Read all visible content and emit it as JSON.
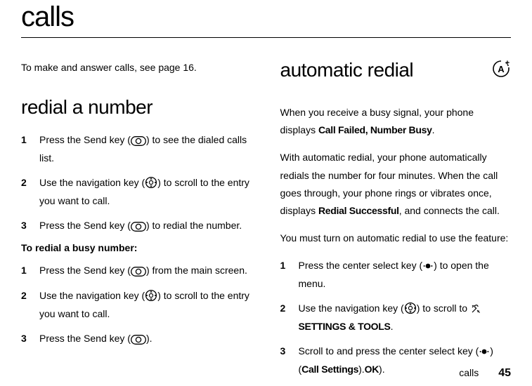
{
  "page_title": "calls",
  "intro": "To make and answer calls, see page 16.",
  "left": {
    "heading": "redial a number",
    "steps_a": [
      "Press the Send key ([SEND]) to see the dialed calls list.",
      "Use the navigation key ([NAV]) to scroll to the entry you want to call.",
      "Press the Send key ([SEND]) to redial the number."
    ],
    "sub_heading_prefix": "To redial a busy number",
    "sub_heading_suffix": ":",
    "steps_b": [
      "Press the Send key ([SEND]) from the main screen.",
      "Use the navigation key ([NAV]) to scroll to the entry you want to call.",
      "Press the Send key ([SEND])."
    ]
  },
  "right": {
    "heading": "automatic redial",
    "para1_a": "When you receive a busy signal, your phone displays ",
    "para1_bold": "Call Failed, Number Busy",
    "para1_b": ".",
    "para2_a": "With automatic redial, your phone automatically redials the number for four minutes. When the call goes through, your phone rings or vibrates once, displays ",
    "para2_bold": "Redial Successful",
    "para2_b": ", and connects the call.",
    "para3": "You must turn on automatic redial to use the feature:",
    "steps": [
      {
        "pre": "Press the center select key (",
        "mid": "[CENTER]",
        "post": ") to open the menu."
      },
      {
        "pre": "Use the navigation key (",
        "mid": "[NAV]",
        "post": ") to scroll to [SETTINGS_ICON] ",
        "bold": "SETTINGS & TOOLS",
        "post2": "."
      },
      {
        "pre": "Scroll to ",
        "bold": "Call Settings",
        "post": " and press the center select key ([CENTER]) (",
        "bold2": "OK",
        "post2": ")."
      }
    ]
  },
  "footer": {
    "label": "calls",
    "page": "45"
  }
}
